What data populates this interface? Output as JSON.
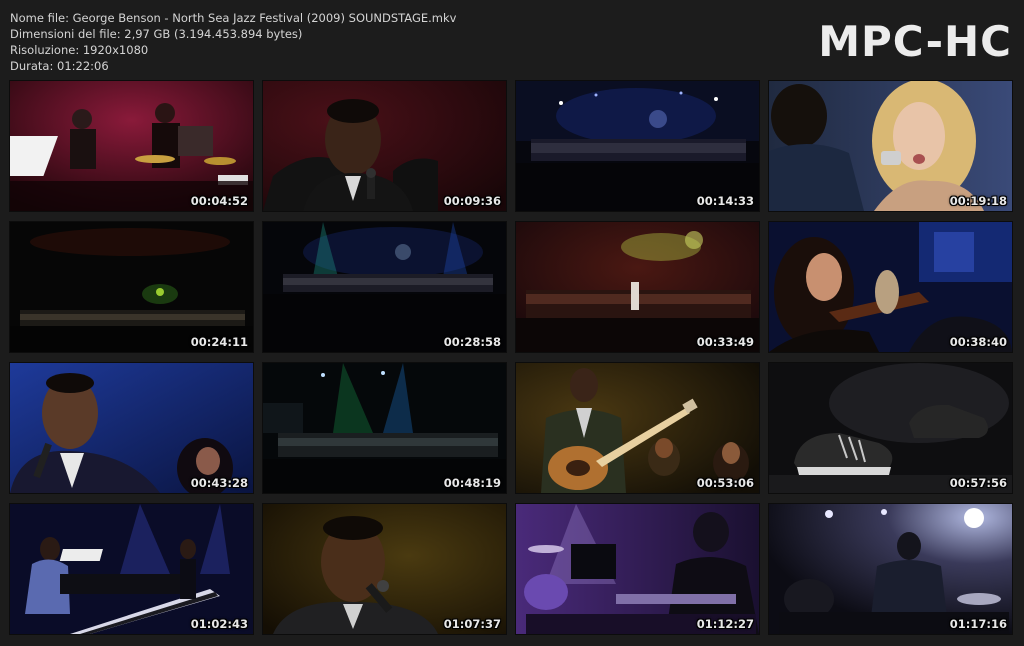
{
  "file_info": {
    "name_line": "Nome file: George Benson - North Sea Jazz Festival (2009) SOUNDSTAGE.mkv",
    "size_line": "Dimensioni del file: 2,97 GB (3.194.453.894 bytes)",
    "resolution_line": "Risoluzione: 1920x1080",
    "duration_line": "Durata: 01:22:06"
  },
  "logo": "MPC-HC",
  "thumbnails": [
    {
      "timestamp": "00:04:52",
      "scene": "band-red-stage"
    },
    {
      "timestamp": "00:09:36",
      "scene": "singer-closeup-mic"
    },
    {
      "timestamp": "00:14:33",
      "scene": "orchestra-wide-blue"
    },
    {
      "timestamp": "00:19:18",
      "scene": "duet-blonde-singer"
    },
    {
      "timestamp": "00:24:11",
      "scene": "orchestra-wide-dark"
    },
    {
      "timestamp": "00:28:58",
      "scene": "orchestra-wide-blue"
    },
    {
      "timestamp": "00:33:49",
      "scene": "stage-wide-logo-red"
    },
    {
      "timestamp": "00:38:40",
      "scene": "violinists-blue"
    },
    {
      "timestamp": "00:43:28",
      "scene": "singer-blue-closeup"
    },
    {
      "timestamp": "00:48:19",
      "scene": "orchestra-wide-green"
    },
    {
      "timestamp": "00:53:06",
      "scene": "guitarist-singing"
    },
    {
      "timestamp": "00:57:56",
      "scene": "sneakers-closeup"
    },
    {
      "timestamp": "01:02:43",
      "scene": "pianist-blue-stage"
    },
    {
      "timestamp": "01:07:37",
      "scene": "singer-closeup-mic-2"
    },
    {
      "timestamp": "01:12:27",
      "scene": "drummer-purple"
    },
    {
      "timestamp": "01:17:16",
      "scene": "drummer-backlit"
    }
  ],
  "colors": {
    "background": "#1c1c1c",
    "text": "#d4d4d4",
    "logo": "#ececec"
  }
}
